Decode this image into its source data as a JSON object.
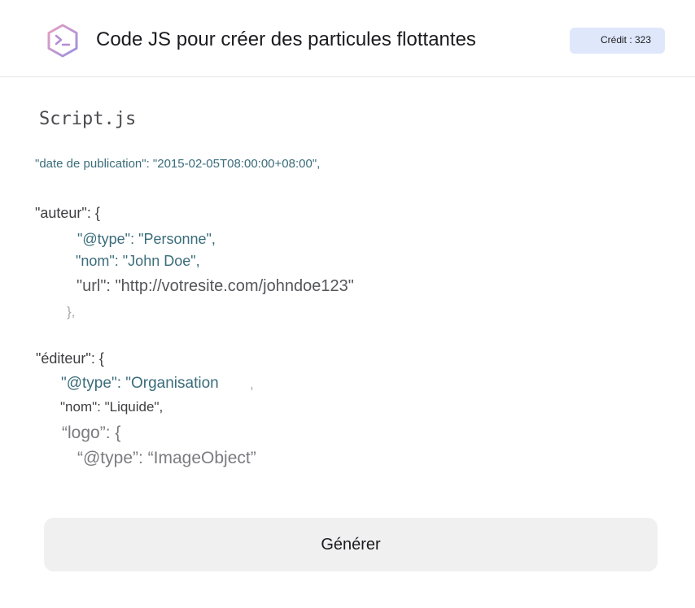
{
  "header": {
    "title": "Code JS pour créer des particules flottantes",
    "credit": "Crédit : 323",
    "logo_icon": "terminal-prompt-icon"
  },
  "file": {
    "name": "Script.js"
  },
  "code": {
    "line1": "\"date de publication\": \"2015-02-05T08:00:00+08:00\",",
    "line2": "\"auteur\": {",
    "line3": "\"@type\": \"Personne\",",
    "line4": "\"nom\": \"John Doe\",",
    "line5": "\"url\": \"http://votresite.com/johndoe123\"",
    "line6": "},",
    "line7": "\"éditeur\": {",
    "line8": "\"@type\": \"Organisation",
    "line8b": ",",
    "line9": "\"nom\": \"Liquide\",",
    "line10": "“logo”: {",
    "line11": "“@type”: “ImageObject”"
  },
  "actions": {
    "generate_label": "Générer"
  },
  "colors": {
    "accent": "#c58fd6",
    "credit_bg": "#dfe7fb",
    "code_teal": "#3a6c7a"
  }
}
